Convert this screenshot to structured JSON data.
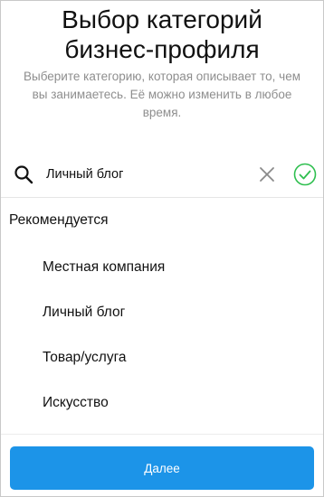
{
  "header": {
    "title_line1": "Выбор категорий",
    "title_line2": "бизнес-профиля",
    "subtitle": "Выберите категорию, которая описывает то, чем вы занимаетесь. Её можно изменить в любое время."
  },
  "search": {
    "value": "Личный блог",
    "icon": "search-icon",
    "clear_icon": "close-icon",
    "confirm_icon": "check-circle-icon",
    "confirm_color": "#2fbf4f"
  },
  "recommended": {
    "label": "Рекомендуется",
    "items": [
      {
        "label": "Местная компания"
      },
      {
        "label": "Личный блог"
      },
      {
        "label": "Товар/услуга"
      },
      {
        "label": "Искусство"
      }
    ]
  },
  "footer": {
    "next_label": "Далее",
    "button_color": "#1c94e8"
  }
}
